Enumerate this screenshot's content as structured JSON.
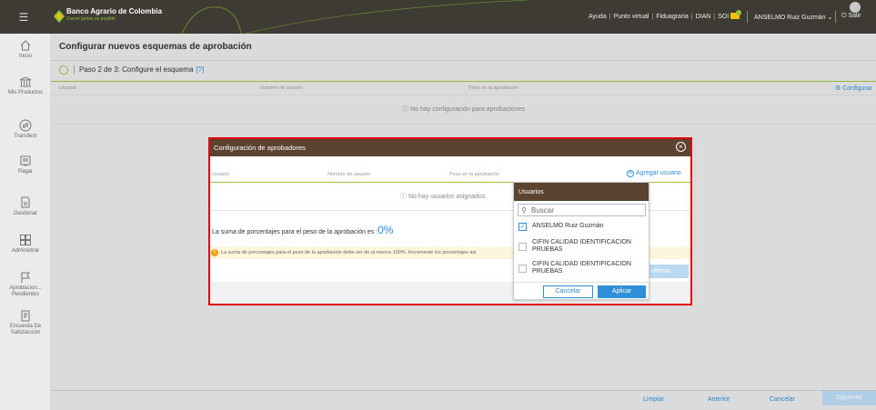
{
  "topbar": {
    "bank_name": "Banco Agrario de Colombia",
    "tagline": "Crecer juntos es posible",
    "links": [
      "Ayuda",
      "Punto virtual",
      "Fiduagraria",
      "DIAN",
      "SOI"
    ],
    "user_name": "ANSELMO Ruiz Guzmán",
    "logout_label": "Salir"
  },
  "sidebar": {
    "items": [
      {
        "label": "Inicio",
        "icon": "home-icon"
      },
      {
        "label": "Mis Productos",
        "icon": "bank-icon"
      },
      {
        "label": "Transferir",
        "icon": "transfer-icon"
      },
      {
        "label": "Pagar",
        "icon": "pay-icon"
      },
      {
        "label": "Gestionar",
        "icon": "manage-icon"
      },
      {
        "label": "Administrar",
        "icon": "admin-grid-icon"
      },
      {
        "label": "Aprobacion... Pendientes",
        "icon": "flag-icon"
      },
      {
        "label": "Encuesta De Satisfacción",
        "icon": "survey-icon"
      }
    ]
  },
  "main": {
    "page_title": "Configurar nuevos esquemas de aprobación",
    "step_label": "Paso 2 de 3: Configure el esquema",
    "help_label": "[?]",
    "columns": [
      "Usuario",
      "Nombre de usuario",
      "Peso en la aprobación"
    ],
    "configure_label": "Configurar",
    "empty_message": "No hay configuración para aprobaciones",
    "footer": {
      "clear": "Limpiar",
      "previous": "Anterior",
      "cancel": "Cancelar",
      "next": "Siguiente"
    }
  },
  "modal": {
    "title": "Configuración de aprobadores",
    "columns": [
      "Usuario",
      "Nombre de usuario",
      "Peso en la aprobación"
    ],
    "add_user_label": "Agregar usuario",
    "empty_message": "No hay usuarios asignados.",
    "sum_label": "La suma de porcentajes para el peso de la aprobación es :",
    "sum_value": "0%",
    "warning": "La suma de porcentajes para el peso de la aprobación debe ser de al menos 100% .Incremente los porcentajes asi",
    "confirm_label": "nfirmar"
  },
  "dropdown": {
    "title": "Usuarios",
    "search_placeholder": "Buscar",
    "options": [
      {
        "label": "ANSELMO Ruiz Guzmán",
        "checked": true
      },
      {
        "label": "CIFIN CALIDAD IDENTIFICACION PRUEBAS",
        "checked": false
      },
      {
        "label": "CIFIN CALIDAD IDENTIFICACION PRUEBAS",
        "checked": false
      }
    ],
    "cancel_label": "Cancelar",
    "apply_label": "Aplicar"
  },
  "colors": {
    "brand_dark": "#3d3b34",
    "modal_header": "#5c4330",
    "accent_green": "#9bc23c",
    "link_blue": "#2f8fd8",
    "highlight_red": "#e3000f"
  }
}
